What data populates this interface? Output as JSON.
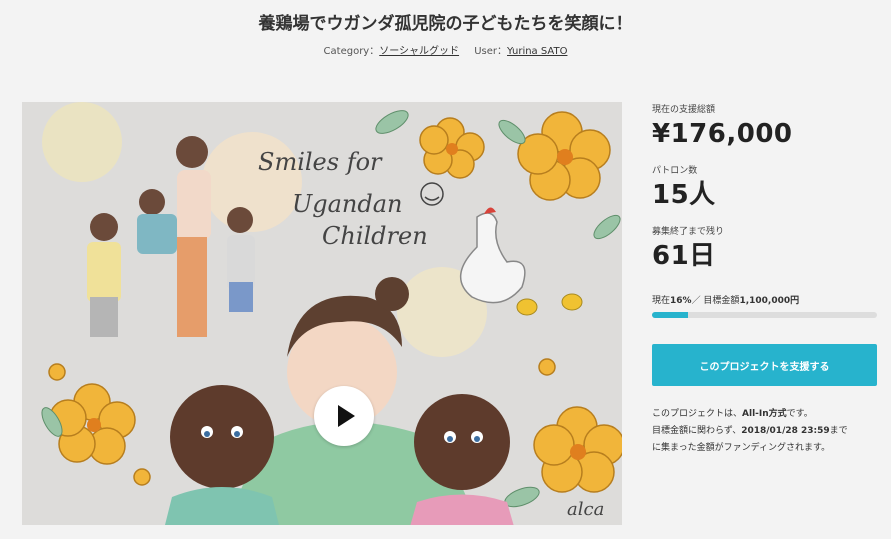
{
  "project": {
    "title": "養鶏場でウガンダ孤児院の子どもたちを笑顔に！",
    "category_label": "Category：",
    "category": "ソーシャルグッド",
    "user_label": "User：",
    "user": "Yurina SATO"
  },
  "media": {
    "artwork_text_line1": "Smiles for",
    "artwork_text_line2": "Ugandan",
    "artwork_text_line3": "Children",
    "signature": "alca",
    "play_icon": "play-icon"
  },
  "stats": {
    "total_label": "現在の支援総額",
    "total_value": "¥176,000",
    "patrons_label": "パトロン数",
    "patrons_value": "15人",
    "remaining_label": "募集終了まで残り",
    "remaining_value": "61日"
  },
  "progress": {
    "prefix": "現在",
    "percent": "16%",
    "separator": "／ 目標金額",
    "goal": "1,100,000円",
    "fraction": 0.16
  },
  "cta": {
    "label": "このプロジェクトを支援する"
  },
  "note": {
    "part1": "このプロジェクトは、",
    "method": "All-In方式",
    "part2": "です。",
    "part3": "目標金額に関わらず、",
    "deadline": "2018/01/28 23:59",
    "part4": "まで",
    "part5": "に集まった金額がファンディングされます。"
  },
  "colors": {
    "accent": "#27b3cd",
    "background": "#f3f3f3"
  }
}
